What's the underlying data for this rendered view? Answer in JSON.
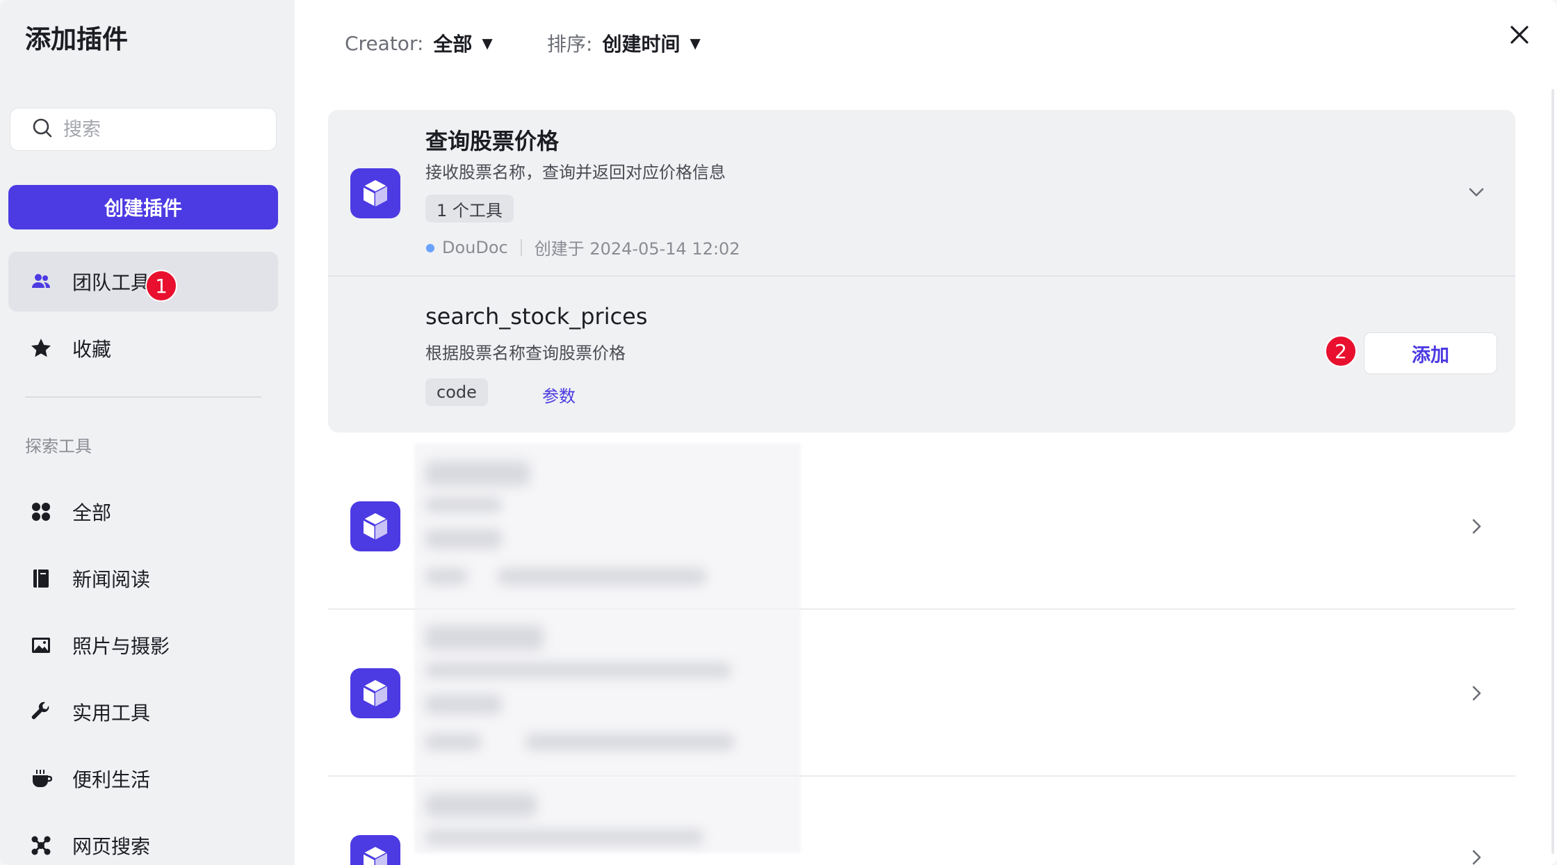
{
  "sidebar": {
    "title": "添加插件",
    "search": {
      "placeholder": "搜索",
      "icon": "search-icon"
    },
    "create_button": "创建插件",
    "team_tools": {
      "label": "团队工具",
      "icon": "users-icon",
      "badge": "1"
    },
    "favorites": {
      "label": "收藏",
      "icon": "star-icon"
    },
    "section_label": "探索工具",
    "categories": [
      {
        "label": "全部",
        "icon": "grid-icon"
      },
      {
        "label": "新闻阅读",
        "icon": "book-icon"
      },
      {
        "label": "照片与摄影",
        "icon": "image-icon"
      },
      {
        "label": "实用工具",
        "icon": "wrench-icon"
      },
      {
        "label": "便利生活",
        "icon": "cup-icon"
      },
      {
        "label": "网页搜索",
        "icon": "network-icon"
      }
    ]
  },
  "filters": {
    "creator_label": "Creator:",
    "creator_value": "全部",
    "sort_label": "排序:",
    "sort_value": "创建时间"
  },
  "plugin": {
    "name": "查询股票价格",
    "description": "接收股票名称，查询并返回对应价格信息",
    "tool_count": "1 个工具",
    "author": "DouDoc",
    "created": "创建于 2024-05-14 12:02",
    "tool": {
      "name": "search_stock_prices",
      "description": "根据股票名称查询股票价格",
      "tag": "code",
      "params_link": "参数",
      "add_button": "添加",
      "badge": "2"
    }
  },
  "colors": {
    "accent": "#4c3ae3",
    "badge": "#e8102e"
  }
}
